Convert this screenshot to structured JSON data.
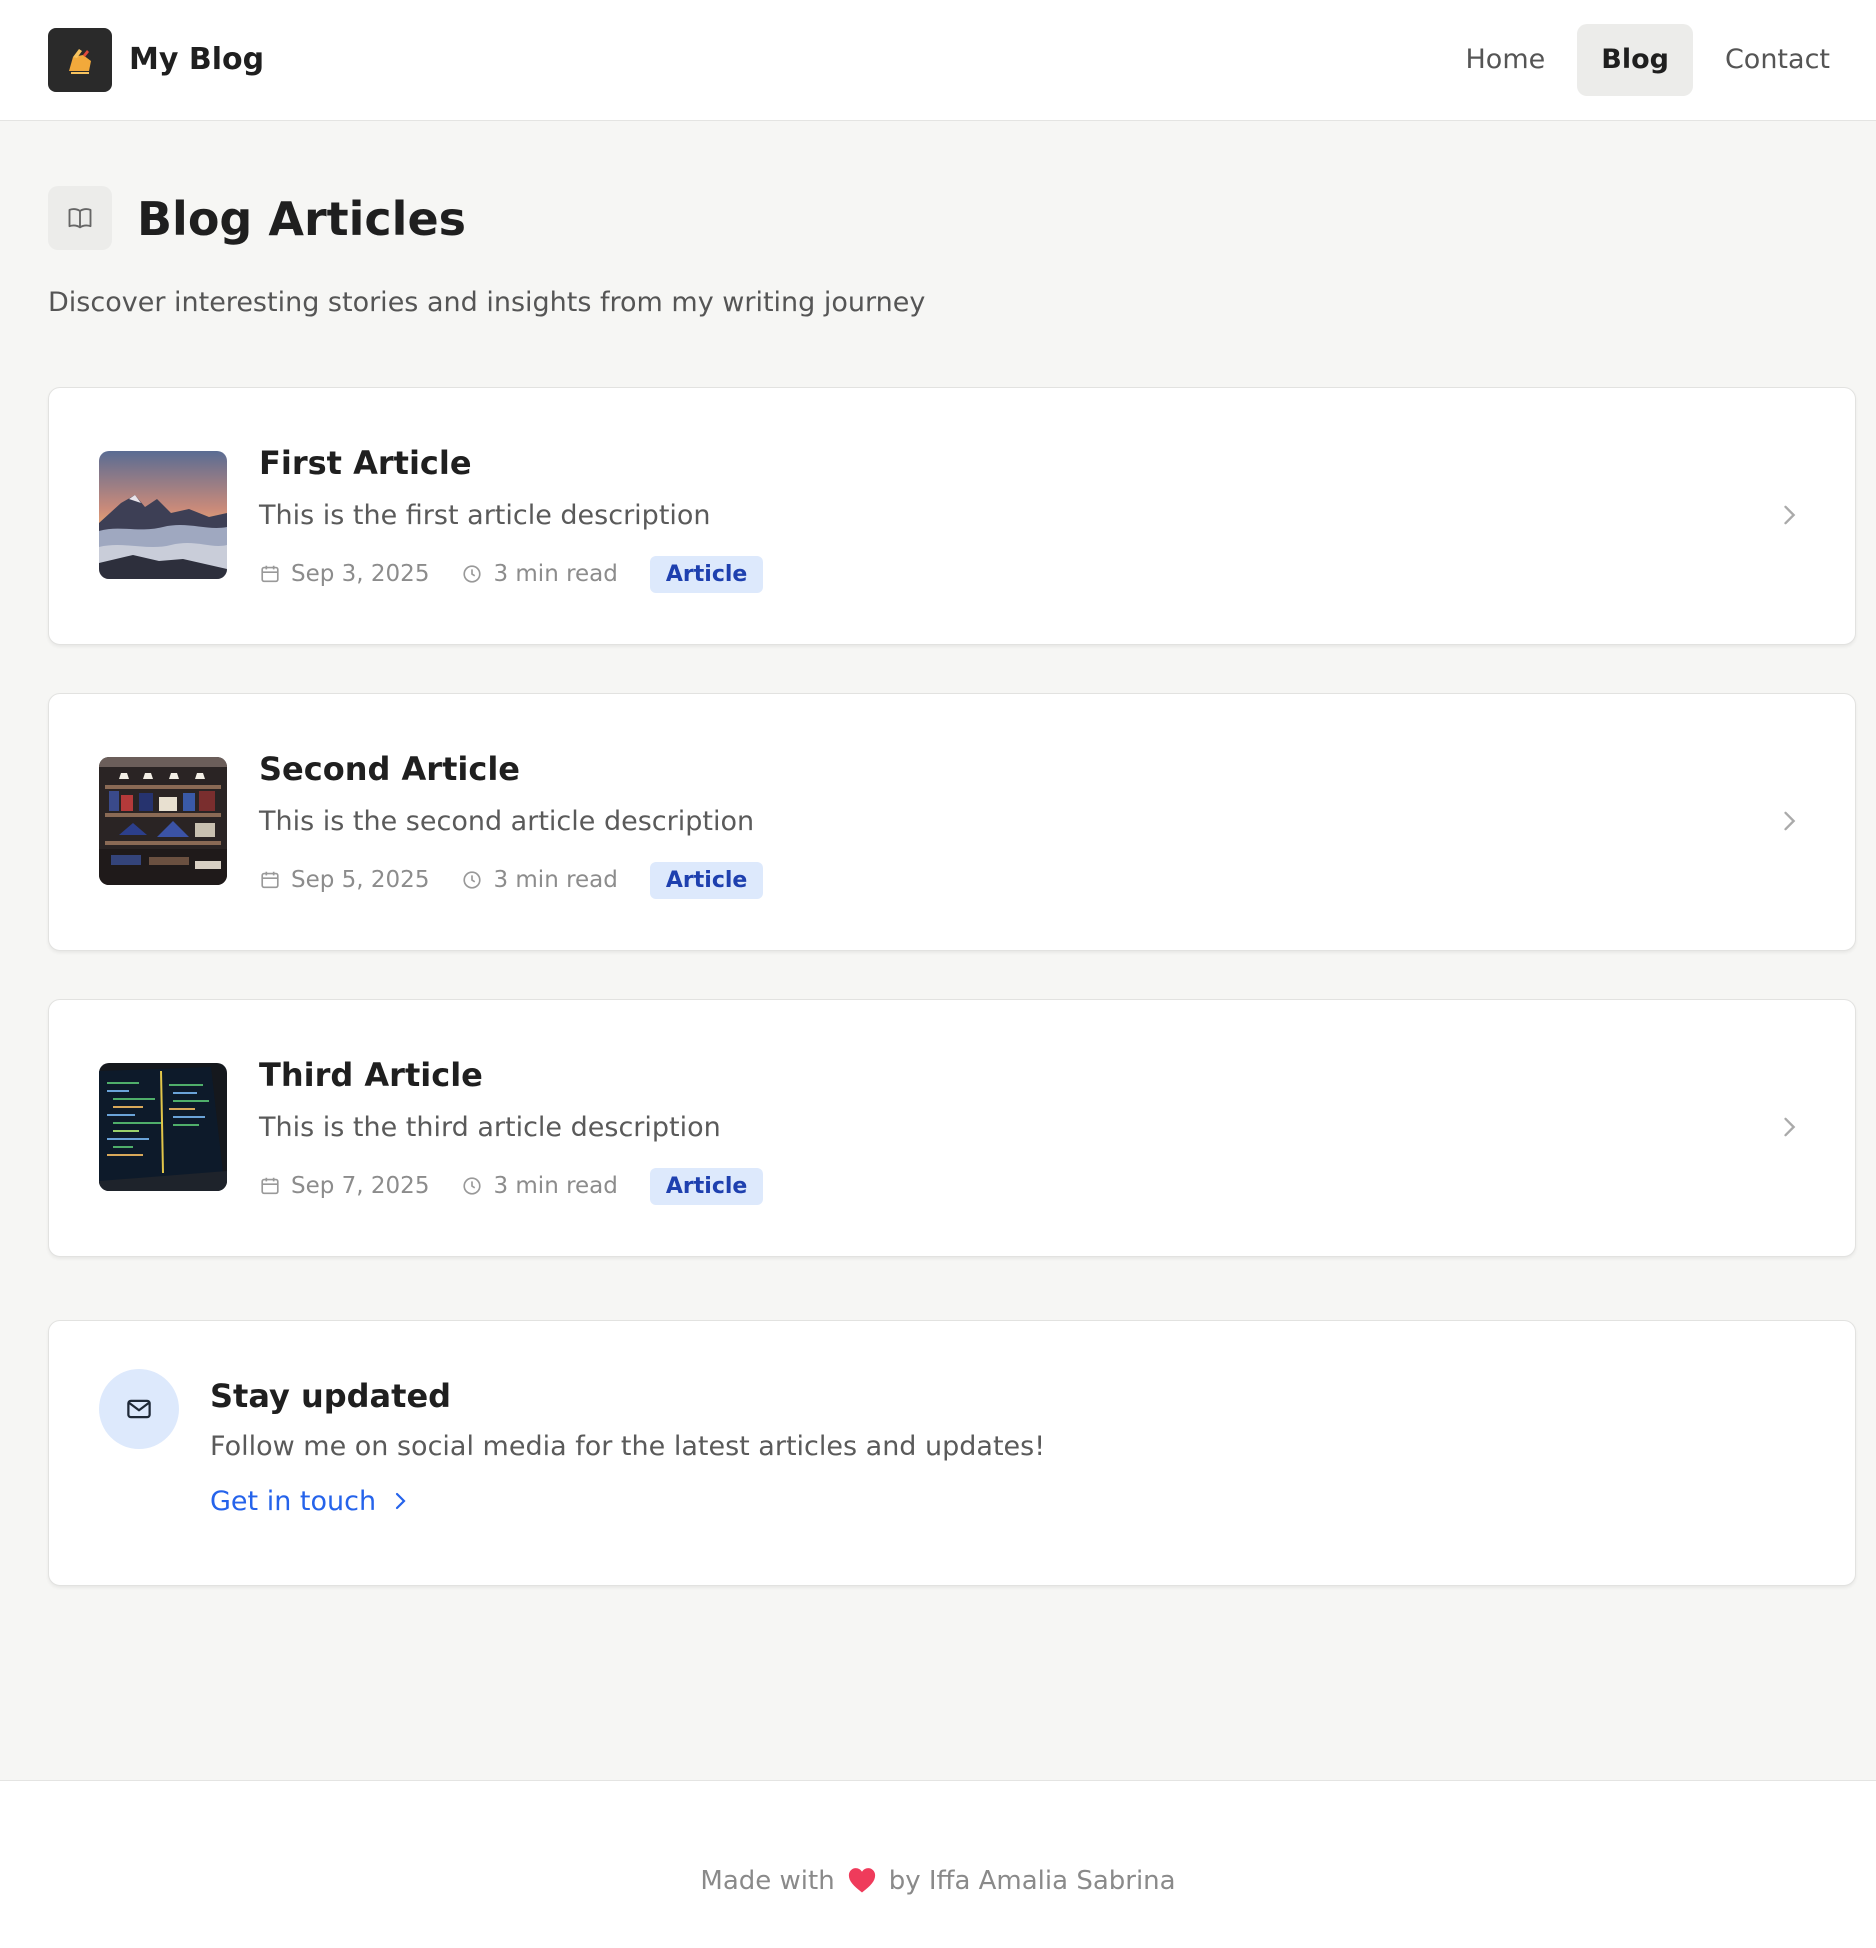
{
  "header": {
    "brand": "My Blog",
    "logo_icon": "writing-hand-icon",
    "nav": [
      {
        "label": "Home",
        "active": false
      },
      {
        "label": "Blog",
        "active": true
      },
      {
        "label": "Contact",
        "active": false
      }
    ]
  },
  "page": {
    "icon": "book-open-icon",
    "title": "Blog Articles",
    "subtitle": "Discover interesting stories and insights from my writing journey"
  },
  "articles": [
    {
      "title": "First Article",
      "description": "This is the first article description",
      "date": "Sep 3, 2025",
      "read_time": "3 min read",
      "tag": "Article",
      "thumbnail": "mountain-sunset-photo"
    },
    {
      "title": "Second Article",
      "description": "This is the second article description",
      "date": "Sep 5, 2025",
      "read_time": "3 min read",
      "tag": "Article",
      "thumbnail": "store-shelves-photo"
    },
    {
      "title": "Third Article",
      "description": "This is the third article description",
      "date": "Sep 7, 2025",
      "read_time": "3 min read",
      "tag": "Article",
      "thumbnail": "laptop-code-photo"
    }
  ],
  "updates": {
    "icon": "mail-icon",
    "title": "Stay updated",
    "text": "Follow me on social media for the latest articles and updates!",
    "link_label": "Get in touch"
  },
  "footer": {
    "prefix": "Made with",
    "heart_icon": "heart-icon",
    "suffix": "by Iffa Amalia Sabrina"
  },
  "colors": {
    "accent": "#2563eb",
    "tag_bg": "#dde9fc",
    "tag_text": "#1e40af",
    "page_bg": "#f6f6f4",
    "heart": "#ef3b5b"
  }
}
